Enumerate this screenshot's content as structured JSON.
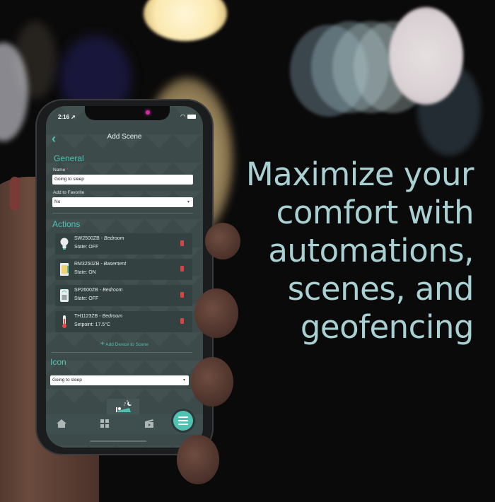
{
  "headline": {
    "lines": [
      "Maximize your",
      "comfort with",
      "automations,",
      "scenes, and",
      "geofencing"
    ]
  },
  "status_bar": {
    "time": "2:16",
    "location_icon": "location-arrow-icon",
    "wifi_icon": "wifi-icon",
    "battery_icon": "battery-icon"
  },
  "header": {
    "back_icon": "chevron-left-icon",
    "title": "Add Scene"
  },
  "general": {
    "section_title": "General",
    "name_label": "Name",
    "name_required_mark": "*",
    "name_value": "Going to sleep",
    "favorite_label": "Add to Favorite",
    "favorite_value": "No"
  },
  "actions": {
    "section_title": "Actions",
    "items": [
      {
        "model": "SW2500ZB",
        "location": "Bedroom",
        "status": "State: OFF",
        "icon": "lightbulb-icon"
      },
      {
        "model": "RM3250ZB",
        "location": "Basement",
        "status": "State: ON",
        "icon": "load-controller-icon"
      },
      {
        "model": "SP2600ZB",
        "location": "Bedroom",
        "status": "State: OFF",
        "icon": "smart-plug-icon"
      },
      {
        "model": "TH1123ZB",
        "location": "Bedroom",
        "status": "Setpoint: 17.5°C",
        "icon": "thermometer-icon"
      }
    ],
    "separator": " - ",
    "add_device_label": "Add Device to Scene",
    "add_device_plus": "+"
  },
  "icon_section": {
    "section_title": "Icon",
    "selected_value": "Going to sleep",
    "preview_icon": "sleeping-person-icon"
  },
  "bottom_nav": {
    "items": [
      {
        "name": "home",
        "icon": "home-icon"
      },
      {
        "name": "dashboard",
        "icon": "grid-icon"
      },
      {
        "name": "scenes",
        "icon": "clapperboard-icon"
      }
    ],
    "menu_icon": "hamburger-menu-icon"
  },
  "colors": {
    "accent": "#4fc2b3",
    "headline": "#a9d1d3",
    "app_background": "#3c4a4a",
    "delete": "#d84346"
  }
}
